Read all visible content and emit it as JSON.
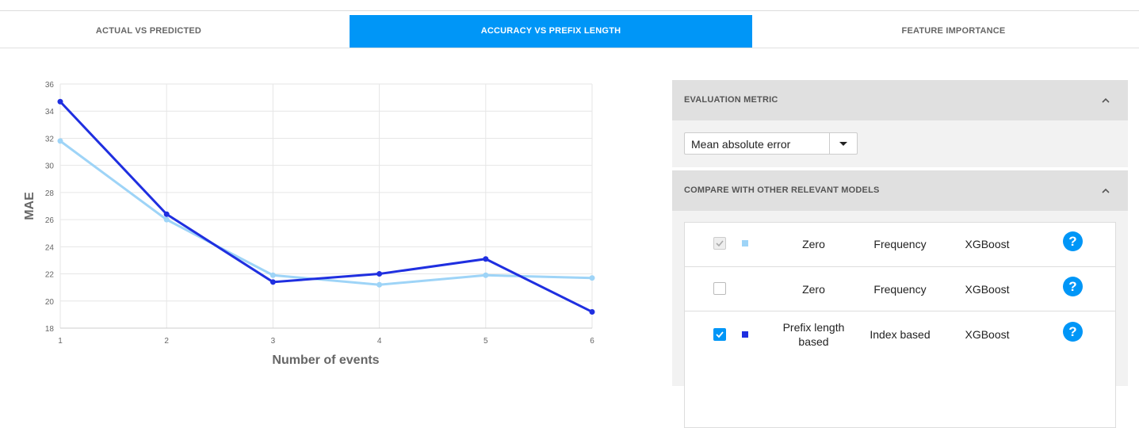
{
  "tabs": [
    {
      "label": "ACTUAL VS PREDICTED"
    },
    {
      "label": "ACCURACY VS PREFIX LENGTH"
    },
    {
      "label": "FEATURE IMPORTANCE"
    }
  ],
  "active_tab": 1,
  "chart_data": {
    "type": "line",
    "xlabel": "Number of events",
    "ylabel": "MAE",
    "x": [
      1,
      2,
      3,
      4,
      5,
      6
    ],
    "xlim": [
      1,
      6
    ],
    "ylim": [
      18,
      36
    ],
    "yticks": [
      18,
      20,
      22,
      24,
      26,
      28,
      30,
      32,
      34,
      36
    ],
    "xticks": [
      1,
      2,
      3,
      4,
      5,
      6
    ],
    "grid": true,
    "series": [
      {
        "color": "#9ed4f7",
        "values": [
          31.8,
          26.0,
          21.9,
          21.2,
          21.9,
          21.7
        ]
      },
      {
        "color": "#1f2fe0",
        "values": [
          34.7,
          26.4,
          21.4,
          22.0,
          23.1,
          19.2
        ]
      }
    ]
  },
  "evaluation": {
    "title": "EVALUATION METRIC",
    "selected": "Mean absolute error",
    "toggle_icon": "chevron-up-icon"
  },
  "compare": {
    "title": "COMPARE WITH OTHER RELEVANT MODELS",
    "toggle_icon": "chevron-up-icon",
    "rows": [
      {
        "checked": true,
        "disabled": true,
        "swatch": "#9ed4f7",
        "prefix": "Zero",
        "encoding": "Frequency",
        "model": "XGBoost",
        "help": "?"
      },
      {
        "checked": false,
        "disabled": false,
        "swatch": "",
        "prefix": "Zero",
        "encoding": "Frequency",
        "model": "XGBoost",
        "help": "?"
      },
      {
        "checked": true,
        "disabled": false,
        "swatch": "#1f2fe0",
        "prefix": "Prefix length based",
        "encoding": "Index based",
        "model": "XGBoost",
        "help": "?"
      }
    ]
  },
  "colors": {
    "accent": "#0096f7"
  }
}
